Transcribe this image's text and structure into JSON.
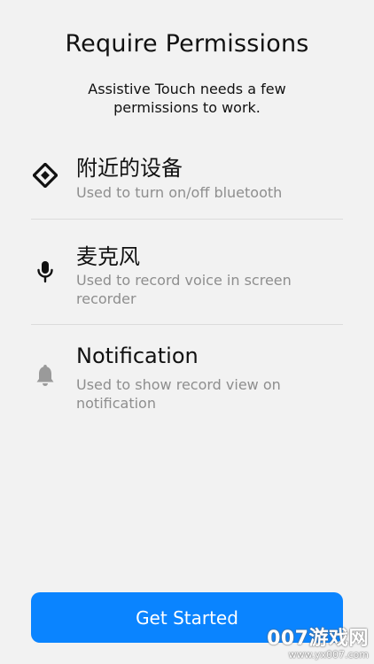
{
  "header": {
    "title": "Require Permissions",
    "subtitle": "Assistive Touch needs a few permissions to work."
  },
  "permissions": [
    {
      "icon": "bluetooth-diamond-icon",
      "title": "附近的设备",
      "description": "Used to turn on/off bluetooth",
      "icon_color": "#111111"
    },
    {
      "icon": "microphone-icon",
      "title": "麦克风",
      "description": "Used to record voice in screen recorder",
      "icon_color": "#111111"
    },
    {
      "icon": "bell-icon",
      "title": "Notification",
      "description": "Used to show record view on notification",
      "icon_color": "#9a9a9a"
    }
  ],
  "cta": {
    "label": "Get Started",
    "color": "#0a84ff"
  },
  "watermark": {
    "main": "007游戏网",
    "sub": "www.yx007.com"
  }
}
